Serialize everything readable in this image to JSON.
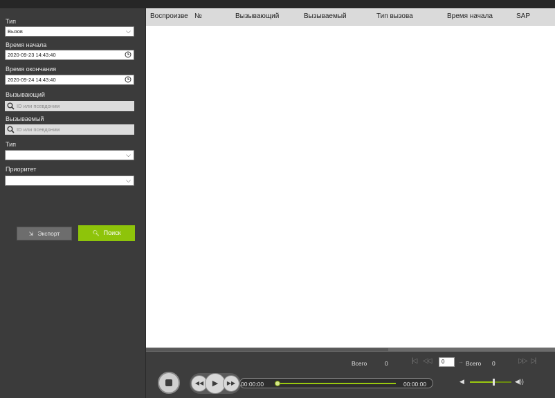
{
  "sidebar": {
    "type_label": "Тип",
    "type_value": "Вызов",
    "start_label": "Время начала",
    "start_value": "2020-09-23 14:43:40",
    "end_label": "Время окончания",
    "end_value": "2020-09-24 14:43:40",
    "caller_label": "Вызывающий",
    "caller_placeholder": "ID или псевдоним",
    "callee_label": "Вызываемый",
    "callee_placeholder": "ID или псевдоним",
    "type2_label": "Тип",
    "type2_value": "",
    "priority_label": "Приоритет",
    "priority_value": "",
    "export_label": "Экспорт",
    "search_label": "Поиск"
  },
  "table": {
    "columns": [
      "Воспроизве",
      "№",
      "Вызывающий",
      "Вызываемый",
      "Тип вызова",
      "Время начала",
      "SAP"
    ]
  },
  "player": {
    "total_label": "Всего",
    "total_value": "0",
    "page_value": "0",
    "pages_label": "Всего",
    "pages_value": "0",
    "current_time": "00:00:00",
    "total_time": "00:00:00",
    "progress": 0,
    "volume": 0.58
  },
  "colors": {
    "accent": "#8ec40a",
    "sidebar": "#3b3b3b",
    "table_header": "#dadada"
  },
  "icons": {
    "dropdown": "chevron-down-icon",
    "clock": "clock-icon",
    "search": "search-icon",
    "export": "export-icon",
    "stop": "stop-icon",
    "rewind": "rewind-icon",
    "play": "play-icon",
    "forward": "fast-forward-icon",
    "first": "first-page-icon",
    "prev": "prev-page-icon",
    "next": "next-page-icon",
    "last": "last-page-icon",
    "volume_low": "volume-low-icon",
    "volume_high": "volume-high-icon"
  }
}
